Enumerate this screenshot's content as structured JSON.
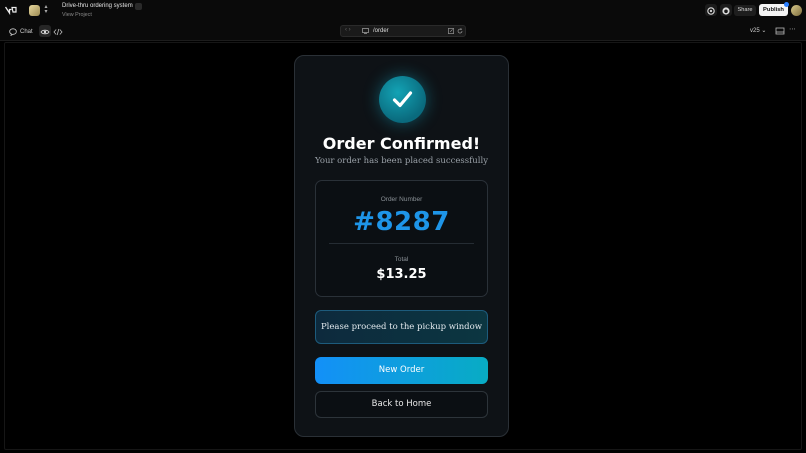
{
  "topbar": {
    "project_name": "Drive-thru ordering system",
    "project_link": "View Project",
    "share_label": "Share",
    "publish_label": "Publish"
  },
  "toolbar": {
    "chat_label": "Chat",
    "url": "/order",
    "version": "v25"
  },
  "app": {
    "title": "Order Confirmed!",
    "subtitle": "Your order has been placed successfully",
    "order_number_label": "Order Number",
    "order_number": "#8287",
    "total_label": "Total",
    "total": "$13.25",
    "pickup_message": "Please proceed to the pickup window",
    "new_order_label": "New Order",
    "back_home_label": "Back to Home"
  },
  "icons": {
    "logo": "v0-logo-icon",
    "check": "check-icon",
    "gear": "gear-icon",
    "github": "github-icon",
    "chat": "chat-bubble-icon",
    "eye": "eye-icon",
    "code": "code-icon"
  },
  "colors": {
    "accent_blue": "#1e95e8",
    "button_gradient_start": "#1390f8",
    "button_gradient_end": "#08acc4",
    "check_circle": "#0a6a7d"
  }
}
